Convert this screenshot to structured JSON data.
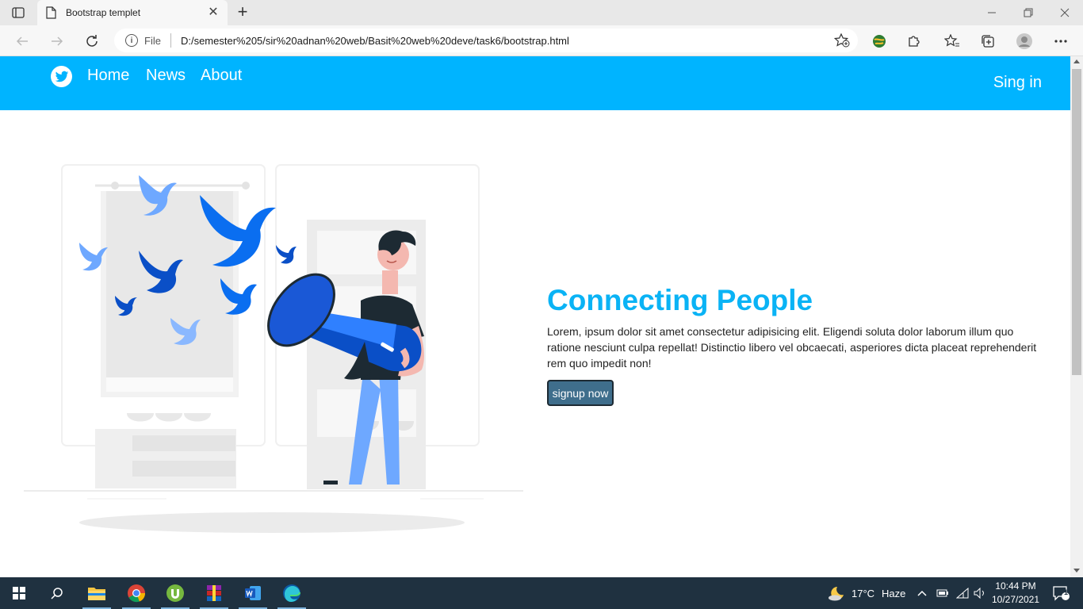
{
  "browser": {
    "tab_title": "Bootstrap templet",
    "tab_close": "✕",
    "new_tab": "+",
    "address_scheme_label": "File",
    "url": "D:/semester%205/sir%20adnan%20web/Basit%20web%20deve/task6/bootstrap.html"
  },
  "site": {
    "nav": {
      "links": [
        "Home",
        "News",
        "About"
      ],
      "signin": "Sing in"
    },
    "hero": {
      "title": "Connecting People",
      "text": "Lorem, ipsum dolor sit amet consectetur adipisicing elit. Eligendi soluta dolor laborum illum quo ratione nesciunt culpa repellat! Distinctio libero vel obcaecati, asperiores dicta placeat reprehenderit rem quo impedit non!",
      "button": "signup now"
    },
    "colors": {
      "nav": "#00b4ff",
      "title": "#0ab3f5",
      "button": "#3f6e8c"
    }
  },
  "taskbar": {
    "weather_temp": "17°C",
    "weather_desc": "Haze",
    "time": "10:44 PM",
    "date": "10/27/2021",
    "notification_count": "1"
  }
}
